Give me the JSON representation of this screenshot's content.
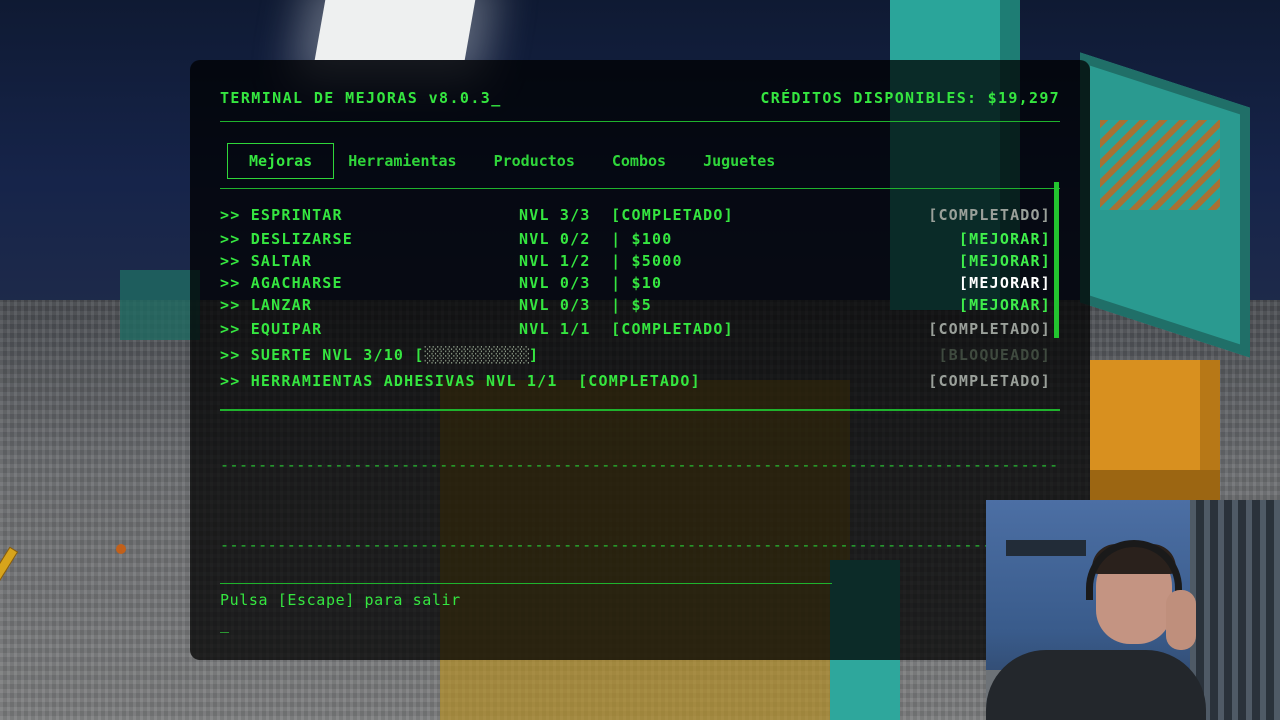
{
  "terminal": {
    "title": "TERMINAL DE MEJORAS v8.0.3_",
    "credits": "CRÉDITOS DISPONIBLES: $19,297",
    "tabs": [
      "Mejoras",
      "Herramientas",
      "Productos",
      "Combos",
      "Juguetes"
    ],
    "active_tab": "Mejoras",
    "rows": [
      {
        "name": ">> ESPRINTAR",
        "level": "NVL 3/3  [COMPLETADO]",
        "action": "[COMPLETADO]",
        "status": "done"
      },
      {
        "name": ">> DESLIZARSE",
        "level": "NVL 0/2  | $100",
        "action": "[MEJORAR]",
        "status": "upgrade"
      },
      {
        "name": ">> SALTAR",
        "level": "NVL 1/2  | $5000",
        "action": "[MEJORAR]",
        "status": "upgrade"
      },
      {
        "name": ">> AGACHARSE",
        "level": "NVL 0/3  | $10",
        "action": "[MEJORAR]",
        "status": "hover"
      },
      {
        "name": ">> LANZAR",
        "level": "NVL 0/3  | $5",
        "action": "[MEJORAR]",
        "status": "upgrade"
      },
      {
        "name": ">> EQUIPAR",
        "level": "NVL 1/1  [COMPLETADO]",
        "action": "[COMPLETADO]",
        "status": "done"
      },
      {
        "name": ">> SUERTE NVL 3/10 [",
        "progress_bar": "░░░░░░░░░░░░░",
        "progress_end": "]",
        "level": "",
        "action": "[BLOQUEADO]",
        "status": "locked"
      },
      {
        "name": ">> HERRAMIENTAS ADHESIVAS NVL 1/1  [COMPLETADO]",
        "level": "",
        "action": "[COMPLETADO]",
        "status": "done"
      }
    ],
    "dash_line_1": "----------------------------------------------------------------------------------------------------------",
    "dash_line_2": "----------------------------------------------------------------------------------------------------------",
    "footer": "Pulsa [Escape] para salir",
    "cursor": "_"
  },
  "colors": {
    "terminal_green": "#35e640",
    "done_gray": "#9aa09a",
    "locked_gray": "#3f4a3f"
  }
}
